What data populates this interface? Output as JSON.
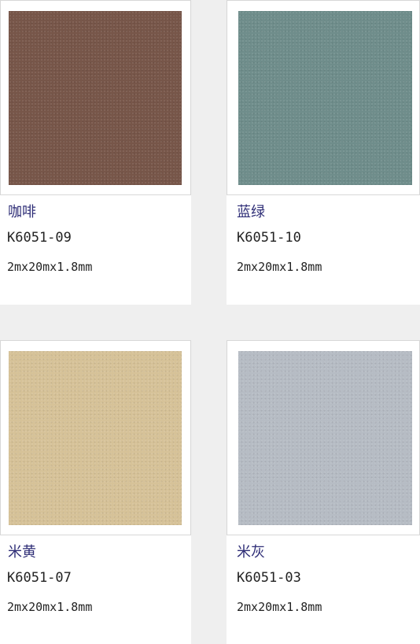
{
  "products": [
    {
      "name": "咖啡",
      "code": "K6051-09",
      "size": "2mx20mx1.8mm",
      "color": "#775649"
    },
    {
      "name": "蓝绿",
      "code": "K6051-10",
      "size": "2mx20mx1.8mm",
      "color": "#6f8d8b"
    },
    {
      "name": "米黄",
      "code": "K6051-07",
      "size": "2mx20mx1.8mm",
      "color": "#d6c298"
    },
    {
      "name": "米灰",
      "code": "K6051-03",
      "size": "2mx20mx1.8mm",
      "color": "#b6bcc4"
    }
  ]
}
